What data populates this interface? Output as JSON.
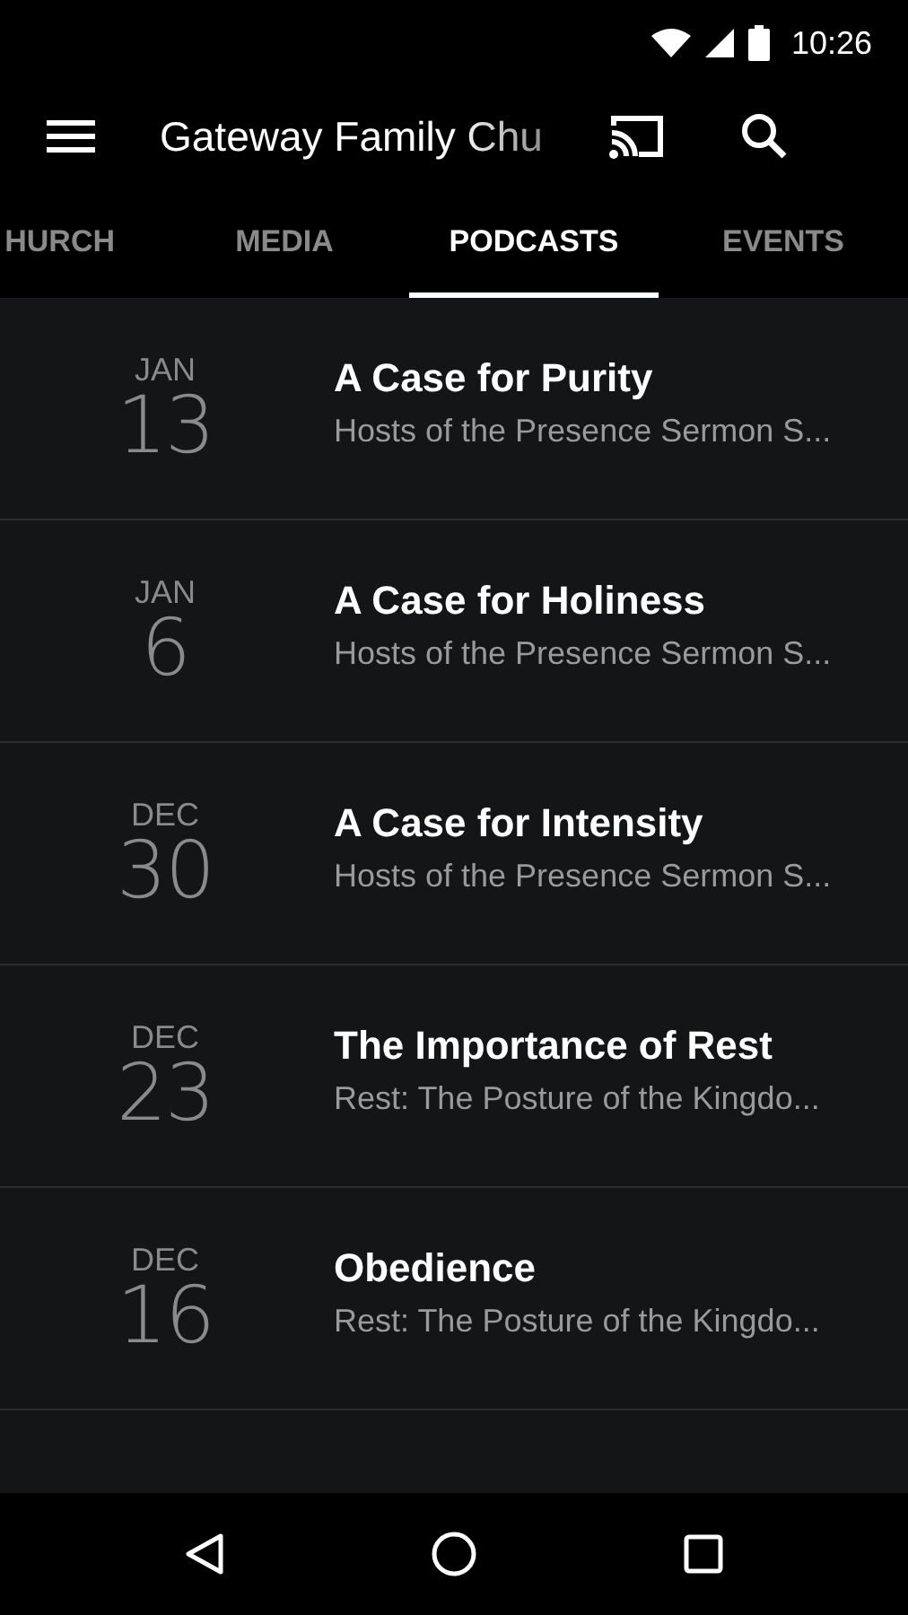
{
  "status_bar": {
    "time": "10:26"
  },
  "toolbar": {
    "title": "Gateway Family Chu"
  },
  "tabs": [
    {
      "label": "HURCH",
      "selected": false
    },
    {
      "label": "MEDIA",
      "selected": false
    },
    {
      "label": "PODCASTS",
      "selected": true
    },
    {
      "label": "EVENTS",
      "selected": false
    }
  ],
  "podcasts": [
    {
      "month": "JAN",
      "day": "13",
      "title": "A Case for Purity",
      "series": "Hosts of the Presence Sermon S..."
    },
    {
      "month": "JAN",
      "day": "6",
      "title": "A Case for Holiness",
      "series": "Hosts of the Presence Sermon S..."
    },
    {
      "month": "DEC",
      "day": "30",
      "title": "A Case for Intensity",
      "series": "Hosts of the Presence Sermon S..."
    },
    {
      "month": "DEC",
      "day": "23",
      "title": "The Importance of Rest",
      "series": "Rest: The Posture of the Kingdo..."
    },
    {
      "month": "DEC",
      "day": "16",
      "title": "Obedience",
      "series": "Rest: The Posture of the Kingdo..."
    }
  ]
}
